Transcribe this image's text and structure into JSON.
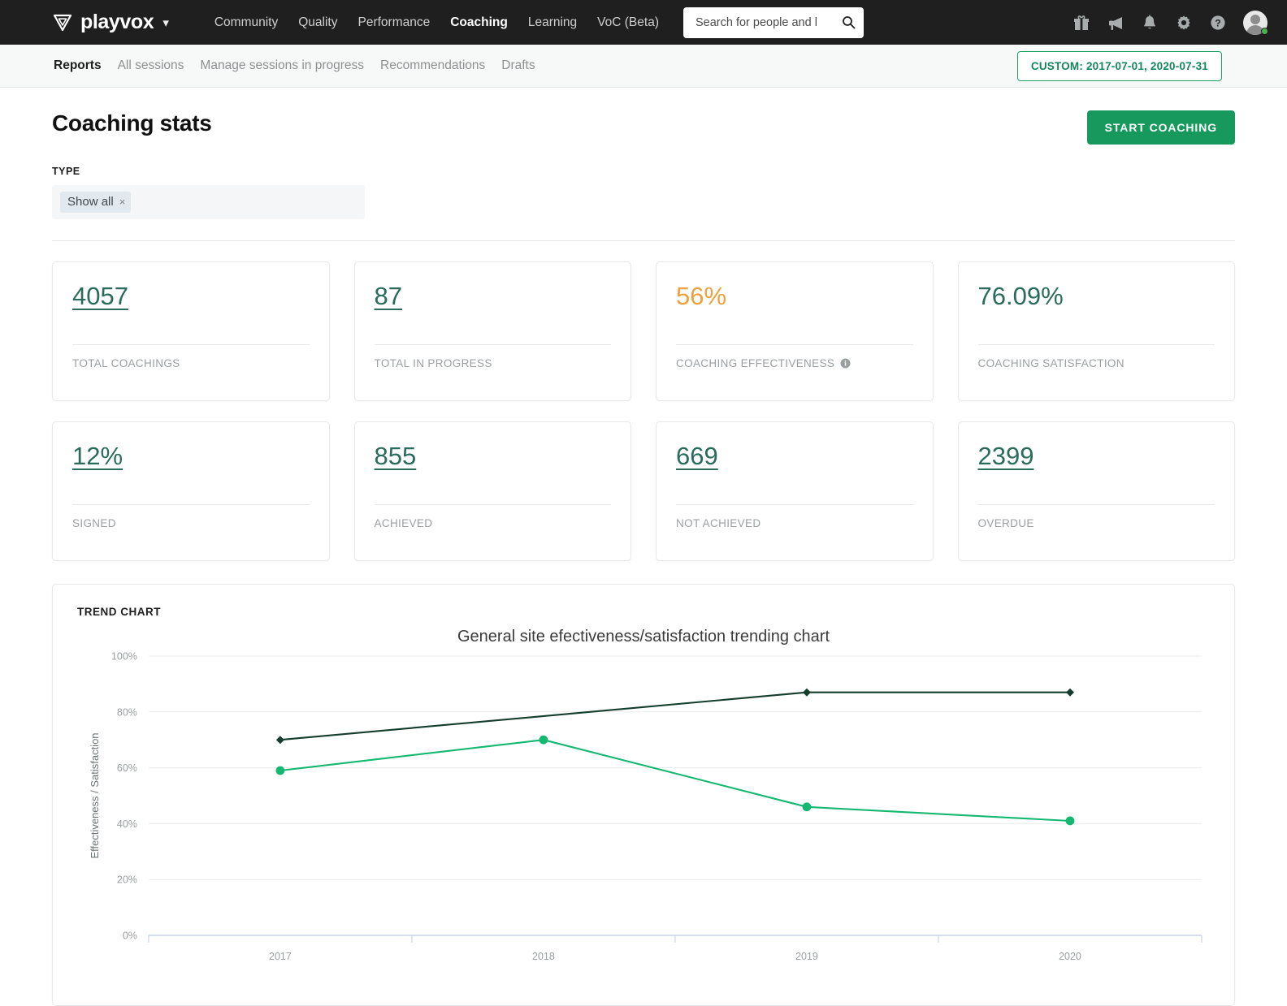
{
  "header": {
    "brand": "playvox",
    "brand_caret_icon": "chevron-down-icon",
    "nav": [
      {
        "label": "Community",
        "active": false
      },
      {
        "label": "Quality",
        "active": false
      },
      {
        "label": "Performance",
        "active": false
      },
      {
        "label": "Coaching",
        "active": true
      },
      {
        "label": "Learning",
        "active": false
      },
      {
        "label": "VoC (Beta)",
        "active": false
      }
    ],
    "search": {
      "placeholder": "Search for people and l",
      "value": "",
      "icon": "search-icon"
    },
    "icons": [
      "gift-icon",
      "megaphone-icon",
      "bell-icon",
      "gear-icon",
      "help-icon",
      "avatar"
    ],
    "status_color": "#4caf50"
  },
  "subnav": {
    "items": [
      {
        "label": "Reports",
        "active": true
      },
      {
        "label": "All sessions",
        "active": false
      },
      {
        "label": "Manage sessions in progress",
        "active": false
      },
      {
        "label": "Recommendations",
        "active": false
      },
      {
        "label": "Drafts",
        "active": false
      }
    ],
    "date_range_label": "CUSTOM: 2017-07-01, 2020-07-31"
  },
  "page": {
    "title": "Coaching stats",
    "start_coaching_label": "START COACHING",
    "filter": {
      "label": "TYPE",
      "tag": "Show all",
      "remove_icon": "×"
    }
  },
  "stats": [
    {
      "value": "4057",
      "label": "TOTAL COACHINGS",
      "link": true,
      "color": "#2a6b5c",
      "info": false
    },
    {
      "value": "87",
      "label": "TOTAL IN PROGRESS",
      "link": true,
      "color": "#2a6b5c",
      "info": false
    },
    {
      "value": "56%",
      "label": "COACHING EFFECTIVENESS",
      "link": false,
      "color": "#eda13b",
      "info": true
    },
    {
      "value": "76.09%",
      "label": "COACHING SATISFACTION",
      "link": false,
      "color": "#2a6b5c",
      "info": false
    },
    {
      "value": "12%",
      "label": "SIGNED",
      "link": true,
      "color": "#2a6b5c",
      "info": false
    },
    {
      "value": "855",
      "label": "ACHIEVED",
      "link": true,
      "color": "#2a6b5c",
      "info": false
    },
    {
      "value": "669",
      "label": "NOT ACHIEVED",
      "link": true,
      "color": "#2a6b5c",
      "info": false
    },
    {
      "value": "2399",
      "label": "OVERDUE",
      "link": true,
      "color": "#2a6b5c",
      "info": false
    }
  ],
  "trend_panel": {
    "title": "TREND CHART"
  },
  "chart_data": {
    "type": "line",
    "title": "General site efectiveness/satisfaction trending chart",
    "xlabel": "",
    "ylabel": "Effectiveness / Satisfaction",
    "categories": [
      "2017",
      "2018",
      "2019",
      "2020"
    ],
    "ylim": [
      0,
      100
    ],
    "yticks": [
      "0%",
      "20%",
      "40%",
      "60%",
      "80%",
      "100%"
    ],
    "ytick_values": [
      0,
      20,
      40,
      60,
      80,
      100
    ],
    "grid": true,
    "legend": "none",
    "series": [
      {
        "name": "Satisfaction",
        "color": "#143d2c",
        "marker": "diamond",
        "x": [
          "2017",
          "2019",
          "2020"
        ],
        "values": [
          70,
          87,
          87
        ]
      },
      {
        "name": "Effectiveness",
        "color": "#14b870",
        "marker": "circle",
        "x": [
          "2017",
          "2018",
          "2019",
          "2020"
        ],
        "values": [
          59,
          70,
          46,
          41
        ]
      }
    ]
  }
}
